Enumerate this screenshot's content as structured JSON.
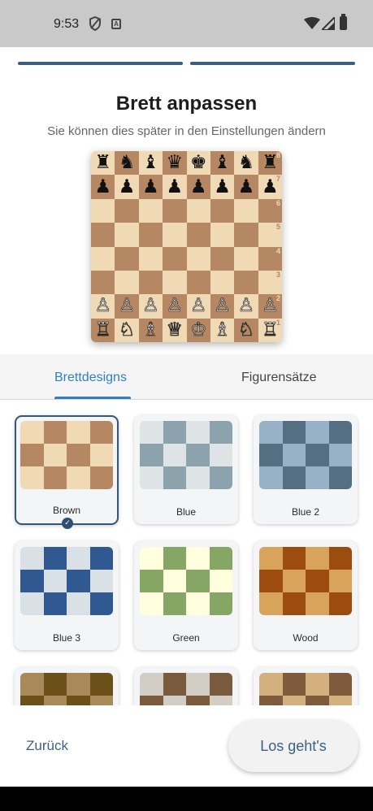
{
  "status_bar": {
    "time": "9:53"
  },
  "header": {
    "title": "Brett anpassen",
    "subtitle": "Sie können dies später in den Einstellungen ändern"
  },
  "board_preview": {
    "light_color": "#f0d9b5",
    "dark_color": "#b58863",
    "rank_labels": [
      "8",
      "7",
      "6",
      "5",
      "4",
      "3",
      "2",
      "1"
    ],
    "rows": [
      [
        "♜",
        "♞",
        "♝",
        "♛",
        "♚",
        "♝",
        "♞",
        "♜"
      ],
      [
        "♟",
        "♟",
        "♟",
        "♟",
        "♟",
        "♟",
        "♟",
        "♟"
      ],
      [
        "",
        "",
        "",
        "",
        "",
        "",
        "",
        ""
      ],
      [
        "",
        "",
        "",
        "",
        "",
        "",
        "",
        ""
      ],
      [
        "",
        "",
        "",
        "",
        "",
        "",
        "",
        ""
      ],
      [
        "",
        "",
        "",
        "",
        "",
        "",
        "",
        ""
      ],
      [
        "♙",
        "♙",
        "♙",
        "♙",
        "♙",
        "♙",
        "♙",
        "♙"
      ],
      [
        "♖",
        "♘",
        "♗",
        "♕",
        "♔",
        "♗",
        "♘",
        "♖"
      ]
    ]
  },
  "tabs": {
    "active": "Brettdesigns",
    "items": [
      {
        "label": "Brettdesigns"
      },
      {
        "label": "Figurensätze"
      }
    ]
  },
  "themes": {
    "selected": "Brown",
    "items": [
      {
        "label": "Brown",
        "light": "#f0d9b5",
        "dark": "#b58863"
      },
      {
        "label": "Blue",
        "light": "#dee3e6",
        "dark": "#8ca2ad"
      },
      {
        "label": "Blue 2",
        "light": "#97b2c7",
        "dark": "#546f82"
      },
      {
        "label": "Blue 3",
        "light": "#d9e0e6",
        "dark": "#315991"
      },
      {
        "label": "Green",
        "light": "#ffffdd",
        "dark": "#86a666"
      },
      {
        "label": "Wood",
        "light": "#d8a45b",
        "dark": "#9b4c0e"
      },
      {
        "label": "",
        "light": "#a8895a",
        "dark": "#6b5119"
      },
      {
        "label": "",
        "light": "#d2cec6",
        "dark": "#7a5a3c"
      },
      {
        "label": "",
        "light": "#d3b07e",
        "dark": "#7f5a3c"
      }
    ]
  },
  "footer": {
    "back_label": "Zurück",
    "go_label": "Los geht's"
  }
}
